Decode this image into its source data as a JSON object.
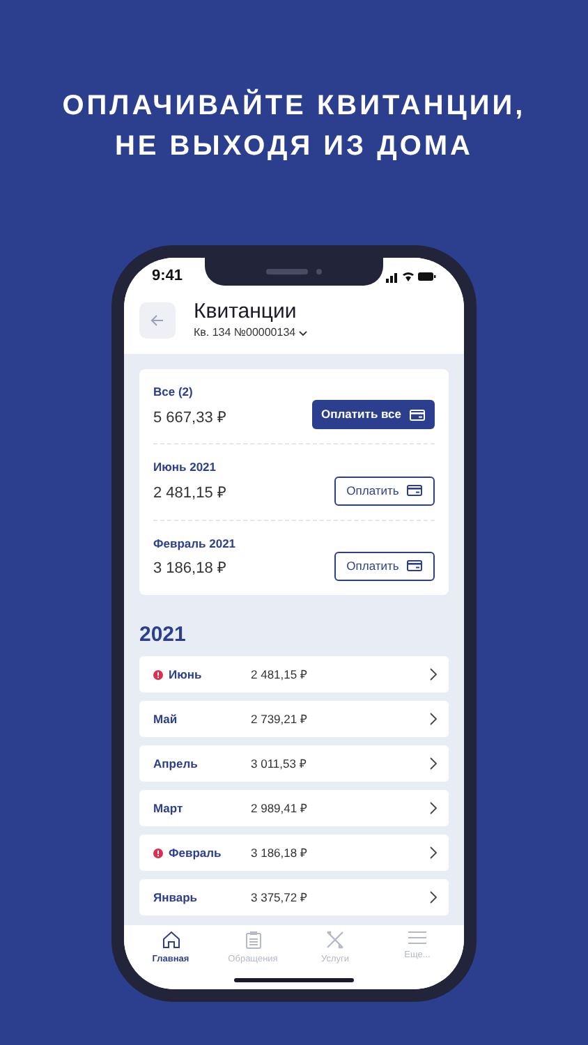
{
  "headline": [
    "ОПЛАЧИВАЙТЕ КВИТАНЦИИ,",
    "НЕ ВЫХОДЯ ИЗ ДОМА"
  ],
  "status_bar": {
    "time": "9:41"
  },
  "header": {
    "title": "Квитанции",
    "subtitle": "Кв. 134 №00000134"
  },
  "payments": [
    {
      "kind": "total",
      "label": "Все (2)",
      "amount": "5 667,33 ₽",
      "button": "Оплатить все"
    },
    {
      "kind": "bill",
      "label": "Июнь 2021",
      "amount": "2 481,15 ₽",
      "button": "Оплатить"
    },
    {
      "kind": "bill",
      "label": "Февраль 2021",
      "amount": "3 186,18 ₽",
      "button": "Оплатить"
    }
  ],
  "year": "2021",
  "months": [
    {
      "month": "Июнь",
      "amount": "2 481,15 ₽",
      "overdue": true
    },
    {
      "month": "Май",
      "amount": "2 739,21 ₽",
      "overdue": false
    },
    {
      "month": "Апрель",
      "amount": "3 011,53 ₽",
      "overdue": false
    },
    {
      "month": "Март",
      "amount": "2 989,41 ₽",
      "overdue": false
    },
    {
      "month": "Февраль",
      "amount": "3 186,18 ₽",
      "overdue": true
    },
    {
      "month": "Январь",
      "amount": "3 375,72 ₽",
      "overdue": false
    }
  ],
  "tabs": [
    {
      "kind": "home",
      "label": "Главная",
      "selected": true
    },
    {
      "kind": "requests",
      "label": "Обращения",
      "selected": false
    },
    {
      "kind": "services",
      "label": "Услуги",
      "selected": false
    },
    {
      "kind": "more",
      "label": "Еще...",
      "selected": false
    }
  ]
}
